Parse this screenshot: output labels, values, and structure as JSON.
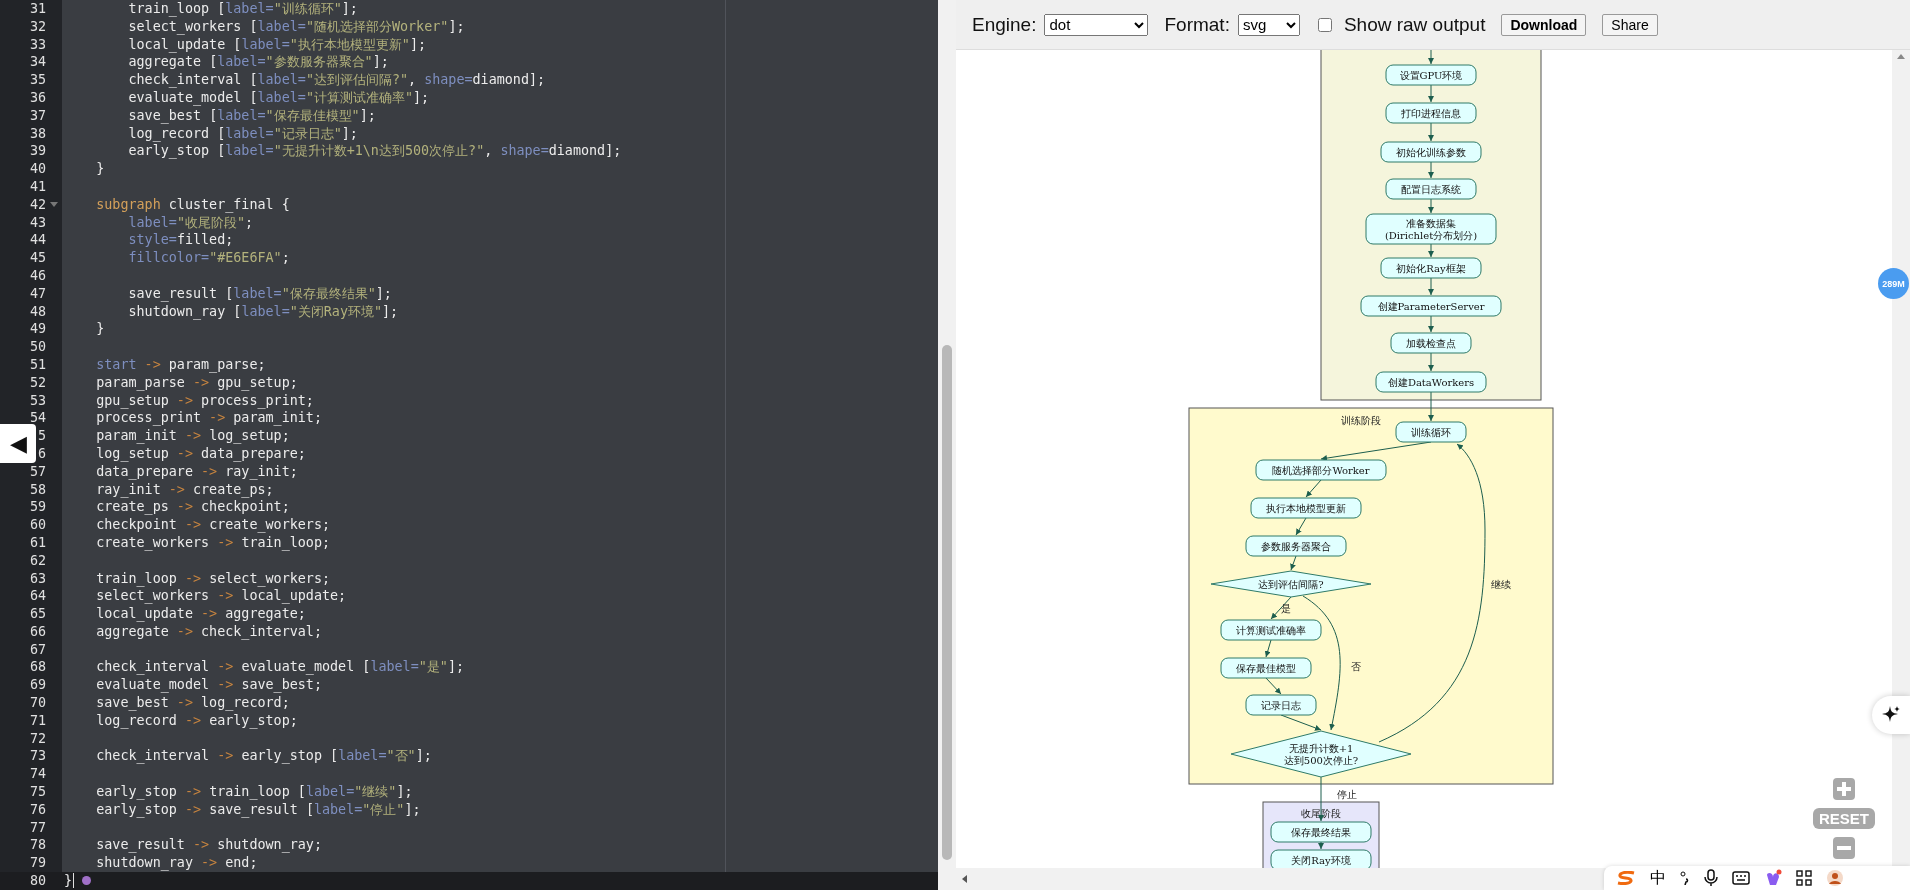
{
  "editor": {
    "lines": [
      {
        "number": "31",
        "current": false,
        "foldable": false,
        "tokens": [
          {
            "kind": "ident",
            "text": "        train_loop "
          },
          {
            "kind": "punct",
            "text": "["
          },
          {
            "kind": "attr",
            "text": "label="
          },
          {
            "kind": "string",
            "text": "\"训练循环\""
          },
          {
            "kind": "punct",
            "text": "];"
          }
        ]
      },
      {
        "number": "32",
        "current": false,
        "foldable": false,
        "tokens": [
          {
            "kind": "ident",
            "text": "        select_workers "
          },
          {
            "kind": "punct",
            "text": "["
          },
          {
            "kind": "attr",
            "text": "label="
          },
          {
            "kind": "string",
            "text": "\"随机选择部分Worker\""
          },
          {
            "kind": "punct",
            "text": "];"
          }
        ]
      },
      {
        "number": "33",
        "current": false,
        "foldable": false,
        "tokens": [
          {
            "kind": "ident",
            "text": "        local_update "
          },
          {
            "kind": "punct",
            "text": "["
          },
          {
            "kind": "attr",
            "text": "label="
          },
          {
            "kind": "string",
            "text": "\"执行本地模型更新\""
          },
          {
            "kind": "punct",
            "text": "];"
          }
        ]
      },
      {
        "number": "34",
        "current": false,
        "foldable": false,
        "tokens": [
          {
            "kind": "ident",
            "text": "        aggregate "
          },
          {
            "kind": "punct",
            "text": "["
          },
          {
            "kind": "attr",
            "text": "label="
          },
          {
            "kind": "string",
            "text": "\"参数服务器聚合\""
          },
          {
            "kind": "punct",
            "text": "];"
          }
        ]
      },
      {
        "number": "35",
        "current": false,
        "foldable": false,
        "tokens": [
          {
            "kind": "ident",
            "text": "        check_interval "
          },
          {
            "kind": "punct",
            "text": "["
          },
          {
            "kind": "attr",
            "text": "label="
          },
          {
            "kind": "string",
            "text": "\"达到评估间隔?\""
          },
          {
            "kind": "punct",
            "text": ", "
          },
          {
            "kind": "attr",
            "text": "shape="
          },
          {
            "kind": "ident",
            "text": "diamond"
          },
          {
            "kind": "punct",
            "text": "];"
          }
        ]
      },
      {
        "number": "36",
        "current": false,
        "foldable": false,
        "tokens": [
          {
            "kind": "ident",
            "text": "        evaluate_model "
          },
          {
            "kind": "punct",
            "text": "["
          },
          {
            "kind": "attr",
            "text": "label="
          },
          {
            "kind": "string",
            "text": "\"计算测试准确率\""
          },
          {
            "kind": "punct",
            "text": "];"
          }
        ]
      },
      {
        "number": "37",
        "current": false,
        "foldable": false,
        "tokens": [
          {
            "kind": "ident",
            "text": "        save_best "
          },
          {
            "kind": "punct",
            "text": "["
          },
          {
            "kind": "attr",
            "text": "label="
          },
          {
            "kind": "string",
            "text": "\"保存最佳模型\""
          },
          {
            "kind": "punct",
            "text": "];"
          }
        ]
      },
      {
        "number": "38",
        "current": false,
        "foldable": false,
        "tokens": [
          {
            "kind": "ident",
            "text": "        log_record "
          },
          {
            "kind": "punct",
            "text": "["
          },
          {
            "kind": "attr",
            "text": "label="
          },
          {
            "kind": "string",
            "text": "\"记录日志\""
          },
          {
            "kind": "punct",
            "text": "];"
          }
        ]
      },
      {
        "number": "39",
        "current": false,
        "foldable": false,
        "tokens": [
          {
            "kind": "ident",
            "text": "        early_stop "
          },
          {
            "kind": "punct",
            "text": "["
          },
          {
            "kind": "attr",
            "text": "label="
          },
          {
            "kind": "string",
            "text": "\"无提升计数+1\\n达到500次停止?\""
          },
          {
            "kind": "punct",
            "text": ", "
          },
          {
            "kind": "attr",
            "text": "shape="
          },
          {
            "kind": "ident",
            "text": "diamond"
          },
          {
            "kind": "punct",
            "text": "];"
          }
        ]
      },
      {
        "number": "40",
        "current": false,
        "foldable": false,
        "tokens": [
          {
            "kind": "punct",
            "text": "    }"
          }
        ]
      },
      {
        "number": "41",
        "current": false,
        "foldable": false
      },
      {
        "number": "42",
        "current": false,
        "foldable": true,
        "tokens": [
          {
            "kind": "keyword",
            "text": "    subgraph"
          },
          {
            "kind": "ident",
            "text": " cluster_final {"
          }
        ]
      },
      {
        "number": "43",
        "current": false,
        "foldable": false,
        "tokens": [
          {
            "kind": "attr",
            "text": "        label="
          },
          {
            "kind": "string",
            "text": "\"收尾阶段\""
          },
          {
            "kind": "punct",
            "text": ";"
          }
        ]
      },
      {
        "number": "44",
        "current": false,
        "foldable": false,
        "tokens": [
          {
            "kind": "attr",
            "text": "        style="
          },
          {
            "kind": "ident",
            "text": "filled;"
          }
        ]
      },
      {
        "number": "45",
        "current": false,
        "foldable": false,
        "tokens": [
          {
            "kind": "attr",
            "text": "        fillcolor="
          },
          {
            "kind": "string",
            "text": "\"#E6E6FA\""
          },
          {
            "kind": "punct",
            "text": ";"
          }
        ]
      },
      {
        "number": "46",
        "current": false,
        "foldable": false
      },
      {
        "number": "47",
        "current": false,
        "foldable": false,
        "tokens": [
          {
            "kind": "ident",
            "text": "        save_result "
          },
          {
            "kind": "punct",
            "text": "["
          },
          {
            "kind": "attr",
            "text": "label="
          },
          {
            "kind": "string",
            "text": "\"保存最终结果\""
          },
          {
            "kind": "punct",
            "text": "];"
          }
        ]
      },
      {
        "number": "48",
        "current": false,
        "foldable": false,
        "tokens": [
          {
            "kind": "ident",
            "text": "        shutdown_ray "
          },
          {
            "kind": "punct",
            "text": "["
          },
          {
            "kind": "attr",
            "text": "label="
          },
          {
            "kind": "string",
            "text": "\"关闭Ray环境\""
          },
          {
            "kind": "punct",
            "text": "];"
          }
        ]
      },
      {
        "number": "49",
        "current": false,
        "foldable": false,
        "tokens": [
          {
            "kind": "punct",
            "text": "    }"
          }
        ]
      },
      {
        "number": "50",
        "current": false,
        "foldable": false
      },
      {
        "number": "51",
        "current": false,
        "foldable": false,
        "tokens": [
          {
            "kind": "builtin",
            "text": "    start"
          },
          {
            "kind": "arrow",
            "text": " -> "
          },
          {
            "kind": "ident",
            "text": "param_parse;"
          }
        ]
      },
      {
        "number": "52",
        "current": false,
        "foldable": false,
        "tokens": [
          {
            "kind": "ident",
            "text": "    param_parse"
          },
          {
            "kind": "arrow",
            "text": " -> "
          },
          {
            "kind": "ident",
            "text": "gpu_setup;"
          }
        ]
      },
      {
        "number": "53",
        "current": false,
        "foldable": false,
        "tokens": [
          {
            "kind": "ident",
            "text": "    gpu_setup"
          },
          {
            "kind": "arrow",
            "text": " -> "
          },
          {
            "kind": "ident",
            "text": "process_print;"
          }
        ]
      },
      {
        "number": "54",
        "current": false,
        "foldable": false,
        "tokens": [
          {
            "kind": "ident",
            "text": "    process_print"
          },
          {
            "kind": "arrow",
            "text": " -> "
          },
          {
            "kind": "ident",
            "text": "param_init;"
          }
        ]
      },
      {
        "number": "5",
        "current": false,
        "foldable": false,
        "tokens": [
          {
            "kind": "ident",
            "text": "    param_init"
          },
          {
            "kind": "arrow",
            "text": " -> "
          },
          {
            "kind": "ident",
            "text": "log_setup;"
          }
        ]
      },
      {
        "number": "6",
        "current": false,
        "foldable": false,
        "tokens": [
          {
            "kind": "ident",
            "text": "    log_setup"
          },
          {
            "kind": "arrow",
            "text": " -> "
          },
          {
            "kind": "ident",
            "text": "data_prepare;"
          }
        ]
      },
      {
        "number": "57",
        "current": false,
        "foldable": false,
        "tokens": [
          {
            "kind": "ident",
            "text": "    data_prepare"
          },
          {
            "kind": "arrow",
            "text": " -> "
          },
          {
            "kind": "ident",
            "text": "ray_init;"
          }
        ]
      },
      {
        "number": "58",
        "current": false,
        "foldable": false,
        "tokens": [
          {
            "kind": "ident",
            "text": "    ray_init"
          },
          {
            "kind": "arrow",
            "text": " -> "
          },
          {
            "kind": "ident",
            "text": "create_ps;"
          }
        ]
      },
      {
        "number": "59",
        "current": false,
        "foldable": false,
        "tokens": [
          {
            "kind": "ident",
            "text": "    create_ps"
          },
          {
            "kind": "arrow",
            "text": " -> "
          },
          {
            "kind": "ident",
            "text": "checkpoint;"
          }
        ]
      },
      {
        "number": "60",
        "current": false,
        "foldable": false,
        "tokens": [
          {
            "kind": "ident",
            "text": "    checkpoint"
          },
          {
            "kind": "arrow",
            "text": " -> "
          },
          {
            "kind": "ident",
            "text": "create_workers;"
          }
        ]
      },
      {
        "number": "61",
        "current": false,
        "foldable": false,
        "tokens": [
          {
            "kind": "ident",
            "text": "    create_workers"
          },
          {
            "kind": "arrow",
            "text": " -> "
          },
          {
            "kind": "ident",
            "text": "train_loop;"
          }
        ]
      },
      {
        "number": "62",
        "current": false,
        "foldable": false
      },
      {
        "number": "63",
        "current": false,
        "foldable": false,
        "tokens": [
          {
            "kind": "ident",
            "text": "    train_loop"
          },
          {
            "kind": "arrow",
            "text": " -> "
          },
          {
            "kind": "ident",
            "text": "select_workers;"
          }
        ]
      },
      {
        "number": "64",
        "current": false,
        "foldable": false,
        "tokens": [
          {
            "kind": "ident",
            "text": "    select_workers"
          },
          {
            "kind": "arrow",
            "text": " -> "
          },
          {
            "kind": "ident",
            "text": "local_update;"
          }
        ]
      },
      {
        "number": "65",
        "current": false,
        "foldable": false,
        "tokens": [
          {
            "kind": "ident",
            "text": "    local_update"
          },
          {
            "kind": "arrow",
            "text": " -> "
          },
          {
            "kind": "ident",
            "text": "aggregate;"
          }
        ]
      },
      {
        "number": "66",
        "current": false,
        "foldable": false,
        "tokens": [
          {
            "kind": "ident",
            "text": "    aggregate"
          },
          {
            "kind": "arrow",
            "text": " -> "
          },
          {
            "kind": "ident",
            "text": "check_interval;"
          }
        ]
      },
      {
        "number": "67",
        "current": false,
        "foldable": false
      },
      {
        "number": "68",
        "current": false,
        "foldable": false,
        "tokens": [
          {
            "kind": "ident",
            "text": "    check_interval"
          },
          {
            "kind": "arrow",
            "text": " -> "
          },
          {
            "kind": "ident",
            "text": "evaluate_model "
          },
          {
            "kind": "punct",
            "text": "["
          },
          {
            "kind": "attr",
            "text": "label="
          },
          {
            "kind": "string",
            "text": "\"是\""
          },
          {
            "kind": "punct",
            "text": "];"
          }
        ]
      },
      {
        "number": "69",
        "current": false,
        "foldable": false,
        "tokens": [
          {
            "kind": "ident",
            "text": "    evaluate_model"
          },
          {
            "kind": "arrow",
            "text": " -> "
          },
          {
            "kind": "ident",
            "text": "save_best;"
          }
        ]
      },
      {
        "number": "70",
        "current": false,
        "foldable": false,
        "tokens": [
          {
            "kind": "ident",
            "text": "    save_best"
          },
          {
            "kind": "arrow",
            "text": " -> "
          },
          {
            "kind": "ident",
            "text": "log_record;"
          }
        ]
      },
      {
        "number": "71",
        "current": false,
        "foldable": false,
        "tokens": [
          {
            "kind": "ident",
            "text": "    log_record"
          },
          {
            "kind": "arrow",
            "text": " -> "
          },
          {
            "kind": "ident",
            "text": "early_stop;"
          }
        ]
      },
      {
        "number": "72",
        "current": false,
        "foldable": false
      },
      {
        "number": "73",
        "current": false,
        "foldable": false,
        "tokens": [
          {
            "kind": "ident",
            "text": "    check_interval"
          },
          {
            "kind": "arrow",
            "text": " -> "
          },
          {
            "kind": "ident",
            "text": "early_stop "
          },
          {
            "kind": "punct",
            "text": "["
          },
          {
            "kind": "attr",
            "text": "label="
          },
          {
            "kind": "string",
            "text": "\"否\""
          },
          {
            "kind": "punct",
            "text": "];"
          }
        ]
      },
      {
        "number": "74",
        "current": false,
        "foldable": false
      },
      {
        "number": "75",
        "current": false,
        "foldable": false,
        "tokens": [
          {
            "kind": "ident",
            "text": "    early_stop"
          },
          {
            "kind": "arrow",
            "text": " -> "
          },
          {
            "kind": "ident",
            "text": "train_loop "
          },
          {
            "kind": "punct",
            "text": "["
          },
          {
            "kind": "attr",
            "text": "label="
          },
          {
            "kind": "string",
            "text": "\"继续\""
          },
          {
            "kind": "punct",
            "text": "];"
          }
        ]
      },
      {
        "number": "76",
        "current": false,
        "foldable": false,
        "tokens": [
          {
            "kind": "ident",
            "text": "    early_stop"
          },
          {
            "kind": "arrow",
            "text": " -> "
          },
          {
            "kind": "ident",
            "text": "save_result "
          },
          {
            "kind": "punct",
            "text": "["
          },
          {
            "kind": "attr",
            "text": "label="
          },
          {
            "kind": "string",
            "text": "\"停止\""
          },
          {
            "kind": "punct",
            "text": "];"
          }
        ]
      },
      {
        "number": "77",
        "current": false,
        "foldable": false
      },
      {
        "number": "78",
        "current": false,
        "foldable": false,
        "tokens": [
          {
            "kind": "ident",
            "text": "    save_result"
          },
          {
            "kind": "arrow",
            "text": " -> "
          },
          {
            "kind": "ident",
            "text": "shutdown_ray;"
          }
        ]
      },
      {
        "number": "79",
        "current": false,
        "foldable": false,
        "tokens": [
          {
            "kind": "ident",
            "text": "    shutdown_ray"
          },
          {
            "kind": "arrow",
            "text": " -> "
          },
          {
            "kind": "ident",
            "text": "end;"
          }
        ]
      },
      {
        "number": "80",
        "current": true,
        "foldable": false,
        "tokens": [
          {
            "kind": "punct",
            "text": "}"
          }
        ]
      }
    ]
  },
  "panel_toggle": "◀",
  "toolbar": {
    "engine_label": "Engine:",
    "engine": "dot",
    "format_label": "Format:",
    "format": "svg",
    "show_raw": {
      "label": "Show raw output",
      "checked": false
    },
    "buttons": [
      {
        "label": "Download",
        "kind": "primary"
      },
      {
        "label": "Share",
        "kind": "plain"
      }
    ]
  },
  "graph": {
    "clusters": [
      {
        "color": "#f5f5dc",
        "nodes": [
          {
            "label": "设置GPU环境",
            "kind": "box"
          },
          {
            "label": "打印进程信息",
            "kind": "box"
          },
          {
            "label": "初始化训练参数",
            "kind": "box"
          },
          {
            "label": "配置日志系统",
            "kind": "box"
          },
          {
            "label": "准备数据集\n(Dirichlet分布划分)",
            "kind": "box"
          },
          {
            "label": "初始化Ray框架",
            "kind": "box"
          },
          {
            "label": "创建ParameterServer",
            "kind": "box"
          },
          {
            "label": "加载检查点",
            "kind": "box"
          },
          {
            "label": "创建DataWorkers",
            "kind": "box"
          }
        ]
      },
      {
        "label": "训练阶段",
        "color": "#fffacd",
        "nodes": [
          {
            "label": "训练循环",
            "kind": "box"
          },
          {
            "label": "随机选择部分Worker",
            "kind": "box"
          },
          {
            "label": "执行本地模型更新",
            "kind": "box"
          },
          {
            "label": "参数服务器聚合",
            "kind": "box"
          },
          {
            "label": "达到评估间隔?",
            "kind": "diamond"
          },
          {
            "label": "计算测试准确率",
            "kind": "box"
          },
          {
            "label": "保存最佳模型",
            "kind": "box"
          },
          {
            "label": "记录日志",
            "kind": "box"
          },
          {
            "label": "无提升计数+1\n达到500次停止?",
            "kind": "diamond"
          }
        ]
      },
      {
        "label": "收尾阶段",
        "color": "#e6e6fa",
        "nodes": [
          {
            "label": "保存最终结果",
            "kind": "box"
          },
          {
            "label": "关闭Ray环境",
            "kind": "box"
          }
        ]
      }
    ],
    "edge_labels": [
      "是",
      "否",
      "继续",
      "停止"
    ]
  },
  "memory_badge": "289M",
  "zoom_controls": {
    "reset": "RESET"
  },
  "ime_bar": {
    "mode": "中"
  }
}
